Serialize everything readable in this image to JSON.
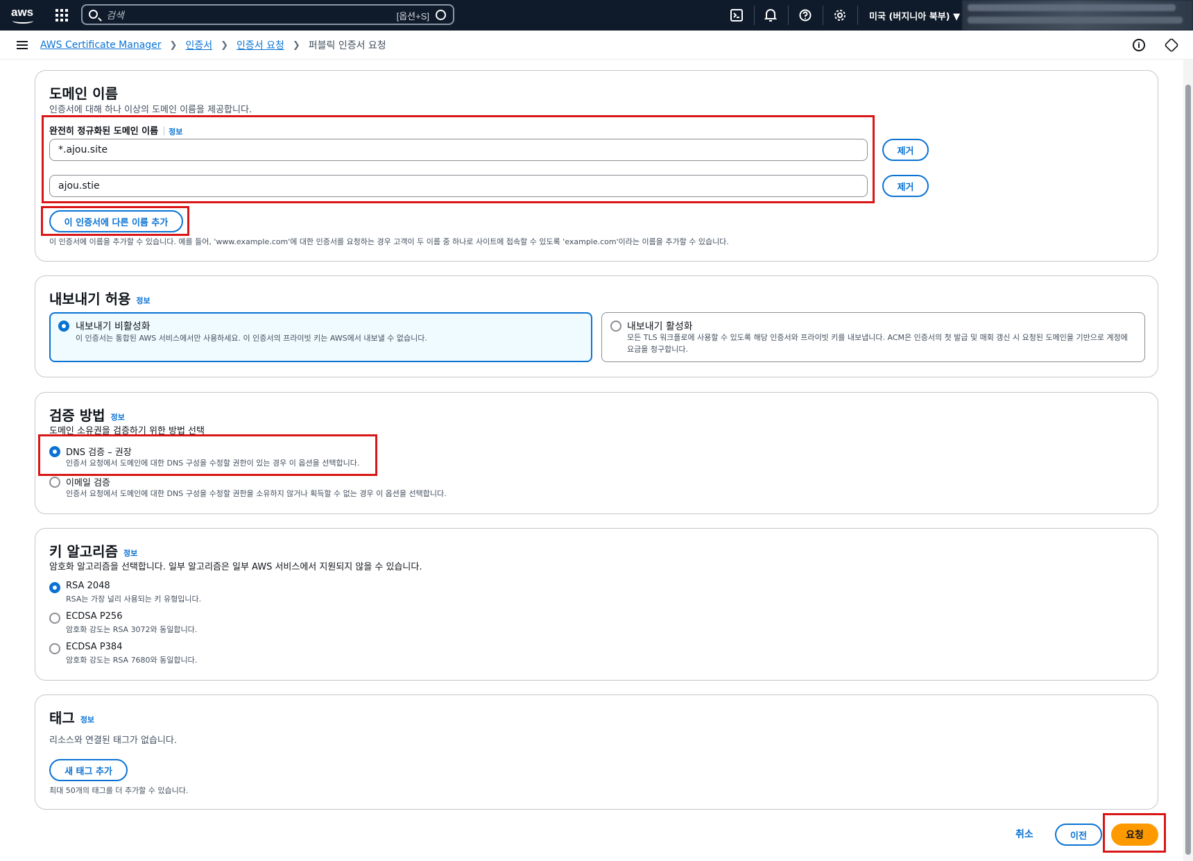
{
  "nav": {
    "logo_text": "aws",
    "search_placeholder": "검색",
    "search_shortcut": "[옵션+S]",
    "region": "미국 (버지니아 북부) ▼"
  },
  "breadcrumb": {
    "items": [
      "AWS Certificate Manager",
      "인증서",
      "인증서 요청"
    ],
    "current": "퍼블릭 인증서 요청"
  },
  "domain_names": {
    "title": "도메인 이름",
    "description": "인증서에 대해 하나 이상의 도메인 이름을 제공합니다.",
    "field_label": "완전히 정규화된 도메인 이름",
    "info": "정보",
    "domains": [
      "*.ajou.site",
      "ajou.stie"
    ],
    "remove_label": "제거",
    "add_button": "이 인증서에 다른 이름 추가",
    "hint": "이 인증서에 이름을 추가할 수 있습니다. 예를 들어, 'www.example.com'에 대한 인증서를 요청하는 경우 고객이 두 이름 중 하나로 사이트에 접속할 수 있도록 'example.com'이라는 이름을 추가할 수 있습니다."
  },
  "export": {
    "title": "내보내기 허용",
    "info": "정보",
    "options": [
      {
        "title": "내보내기 비활성화",
        "desc": "이 인증서는 통합된 AWS 서비스에서만 사용하세요. 이 인증서의 프라이빗 키는 AWS에서 내보낼 수 없습니다.",
        "selected": true
      },
      {
        "title": "내보내기 활성화",
        "desc": "모든 TLS 워크플로에 사용할 수 있도록 해당 인증서와 프라이빗 키를 내보냅니다. ACM은 인증서의 첫 발급 및 매회 갱신 시 요청된 도메인을 기반으로 계정에 요금을 청구합니다.",
        "selected": false
      }
    ]
  },
  "validation": {
    "title": "검증 방법",
    "info": "정보",
    "description": "도메인 소유권을 검증하기 위한 방법 선택",
    "options": [
      {
        "title": "DNS 검증 – 권장",
        "desc": "인증서 요청에서 도메인에 대한 DNS 구성을 수정할 권한이 있는 경우 이 옵션을 선택합니다.",
        "selected": true
      },
      {
        "title": "이메일 검증",
        "desc": "인증서 요청에서 도메인에 대한 DNS 구성을 수정할 권한을 소유하지 않거나 획득할 수 없는 경우 이 옵션을 선택합니다.",
        "selected": false
      }
    ]
  },
  "key_algorithm": {
    "title": "키 알고리즘",
    "info": "정보",
    "description": "암호화 알고리즘을 선택합니다. 일부 알고리즘은 일부 AWS 서비스에서 지원되지 않을 수 있습니다.",
    "options": [
      {
        "title": "RSA 2048",
        "desc": "RSA는 가장 널리 사용되는 키 유형입니다.",
        "selected": true
      },
      {
        "title": "ECDSA P256",
        "desc": "암호화 강도는 RSA 3072와 동일합니다.",
        "selected": false
      },
      {
        "title": "ECDSA P384",
        "desc": "암호화 강도는 RSA 7680와 동일합니다.",
        "selected": false
      }
    ]
  },
  "tags": {
    "title": "태그",
    "info": "정보",
    "description": "리소스와 연결된 태그가 없습니다.",
    "add_button": "새 태그 추가",
    "hint": "최대 50개의 태그를 더 추가할 수 있습니다."
  },
  "footer": {
    "cancel": "취소",
    "previous": "이전",
    "submit": "요청"
  },
  "colors": {
    "accent": "#0972d3",
    "primary_button": "#ff9900",
    "highlight": "#d91515",
    "nav_bg": "#0f1b2a"
  }
}
